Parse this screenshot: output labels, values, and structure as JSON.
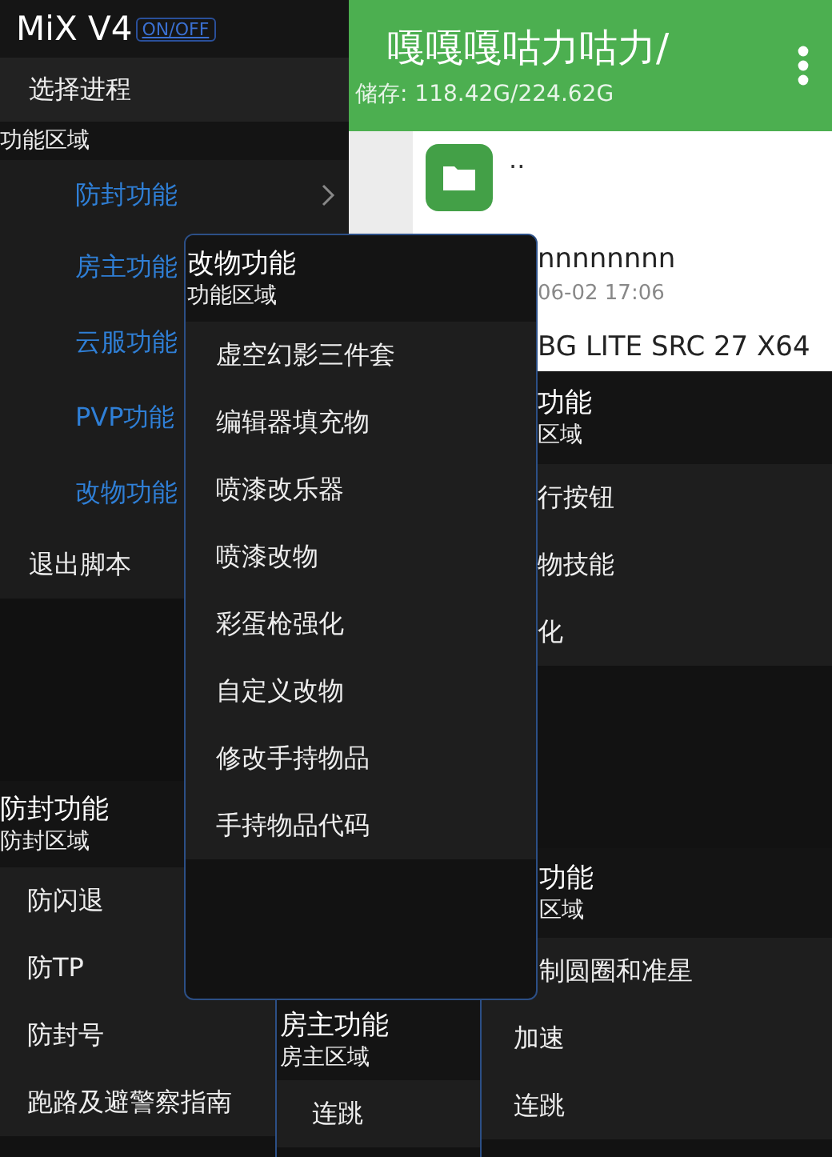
{
  "background_app": {
    "title": "嘎嘎嘎咕力咕力/",
    "storage": "储存: 118.42G/224.62G",
    "files": [
      {
        "kind": "folder",
        "name": ".."
      },
      {
        "kind": "file",
        "name": "nnnnnnnn",
        "date": "06-02 17:06"
      },
      {
        "kind": "file",
        "name": "BG LITE SRC 27 X64"
      }
    ]
  },
  "main_menu": {
    "title": "MiX V4",
    "toggle": "ON/OFF",
    "items": [
      {
        "kind": "action",
        "label": "选择进程"
      },
      {
        "kind": "section",
        "label": "功能区域"
      },
      {
        "kind": "submenu",
        "label": "防封功能",
        "arrow": true
      },
      {
        "kind": "submenu",
        "label": "房主功能"
      },
      {
        "kind": "submenu",
        "label": "云服功能"
      },
      {
        "kind": "submenu",
        "label": "PVP功能"
      },
      {
        "kind": "submenu",
        "label": "改物功能"
      },
      {
        "kind": "action",
        "label": "退出脚本"
      }
    ]
  },
  "panels": [
    {
      "title": "功能",
      "section": "区域",
      "items": [
        "行按钮",
        "物技能",
        "化"
      ]
    },
    {
      "title": "防封功能",
      "section": "防封区域",
      "items": [
        "防闪退",
        "防TP",
        "防封号",
        "跑路及避警察指南"
      ]
    },
    {
      "title": "房主功能",
      "section": "房主区域",
      "items": [
        "连跳"
      ]
    },
    {
      "title": "功能",
      "section": "区域",
      "items": [
        "制圆圈和准星",
        "加速",
        "连跳"
      ]
    },
    {
      "title": "改物功能",
      "section": "功能区域",
      "items": [
        "虚空幻影三件套",
        "编辑器填充物",
        "喷漆改乐器",
        "喷漆改物",
        "彩蛋枪强化",
        "自定义改物",
        "修改手持物品",
        "手持物品代码"
      ]
    }
  ]
}
